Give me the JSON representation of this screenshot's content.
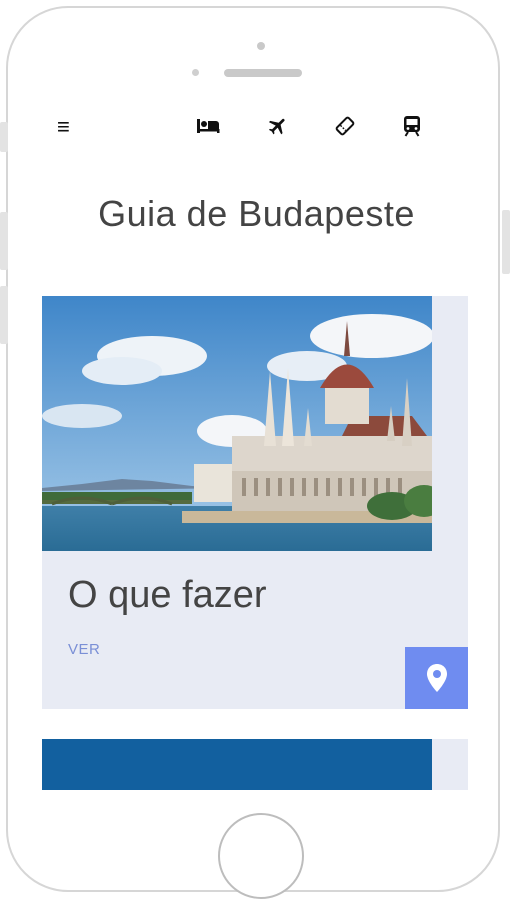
{
  "app": {
    "title": "Guia de Budapeste"
  },
  "toolbar": {
    "menu_icon": "menu-icon",
    "icons": [
      "hotel-bed-icon",
      "airplane-icon",
      "ticket-icon",
      "train-icon"
    ]
  },
  "cards": [
    {
      "title": "O que fazer",
      "link_label": "VER",
      "image": "budapest-parliament-photo",
      "action_icon": "map-pin-icon"
    }
  ],
  "colors": {
    "card_bg": "#e8ebf4",
    "accent": "#6f8cf0",
    "link": "#7a8fd6",
    "title": "#444444"
  }
}
